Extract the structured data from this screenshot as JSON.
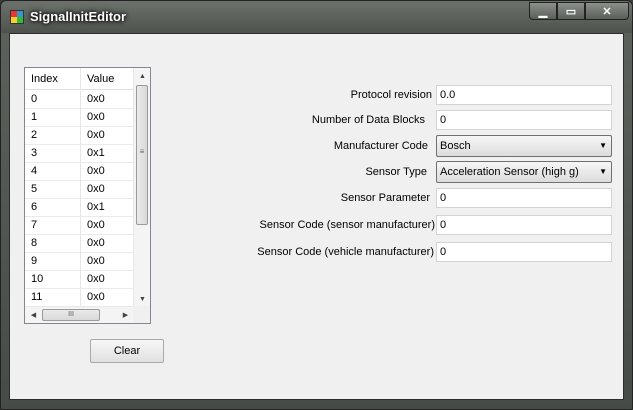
{
  "window": {
    "title": "SignalInitEditor",
    "controls": {
      "minimize": "▁",
      "maximize": "▭",
      "close": "✕"
    }
  },
  "grid": {
    "headers": {
      "index": "Index",
      "value": "Value"
    },
    "rows": [
      {
        "index": "0",
        "value": "0x0"
      },
      {
        "index": "1",
        "value": "0x0"
      },
      {
        "index": "2",
        "value": "0x0"
      },
      {
        "index": "3",
        "value": "0x1"
      },
      {
        "index": "4",
        "value": "0x0"
      },
      {
        "index": "5",
        "value": "0x0"
      },
      {
        "index": "6",
        "value": "0x1"
      },
      {
        "index": "7",
        "value": "0x0"
      },
      {
        "index": "8",
        "value": "0x0"
      },
      {
        "index": "9",
        "value": "0x0"
      },
      {
        "index": "10",
        "value": "0x0"
      },
      {
        "index": "11",
        "value": "0x0"
      }
    ],
    "scroll_grip": "≡",
    "hscroll_grip": "III"
  },
  "clear_button": "Clear",
  "form": {
    "protocol_revision": {
      "label": "Protocol revision",
      "value": "0.0"
    },
    "num_data_blocks": {
      "label": "Number of Data Blocks",
      "value": "0"
    },
    "manufacturer_code": {
      "label": "Manufacturer Code",
      "value": "Bosch"
    },
    "sensor_type": {
      "label": "Sensor Type",
      "value": "Acceleration Sensor (high g)"
    },
    "sensor_parameter": {
      "label": "Sensor Parameter",
      "value": "0"
    },
    "sensor_code_sensor": {
      "label": "Sensor Code (sensor manufacturer)",
      "value": "0"
    },
    "sensor_code_vehicle": {
      "label": "Sensor Code (vehicle manufacturer)",
      "value": "0"
    }
  }
}
